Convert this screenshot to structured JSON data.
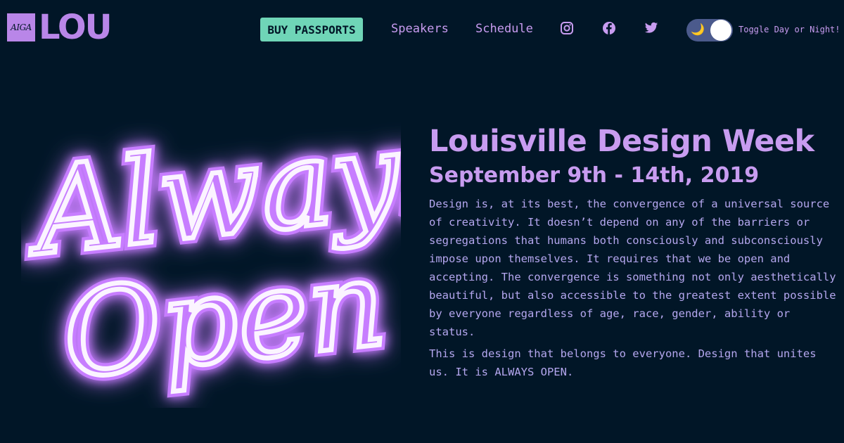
{
  "header": {
    "logo_badge": "AIGA",
    "logo_text": "LOU",
    "buy_label": "BUY PASSPORTS",
    "nav": [
      "Speakers",
      "Schedule"
    ],
    "social_icons": [
      "instagram-icon",
      "facebook-icon",
      "twitter-icon"
    ],
    "toggle_label": "Toggle Day or Night!",
    "toggle_icon": "moon-icon"
  },
  "hero": {
    "neon_line1": "Always",
    "neon_line2": "Open",
    "title": "Louisville Design Week",
    "dates": "September 9th - 14th, 2019",
    "paragraph1": "Design is, at its best, the convergence of a universal source of creativity. It doesn’t depend on any of the barriers or segregations that humans both consciously and subconsciously impose upon themselves. It requires that we be open and accepting. The convergence is something not only aesthetically beautiful, but also accessible to the greatest extent possible by everyone regardless of age, race, gender, ability or status.",
    "paragraph2": "This is design that belongs to everyone. Design that unites us. It is ALWAYS OPEN."
  },
  "colors": {
    "background": "#011627",
    "accent_purple": "#c89cf0",
    "button_teal": "#6fd5b7",
    "neon_glow": "#c77dff"
  }
}
